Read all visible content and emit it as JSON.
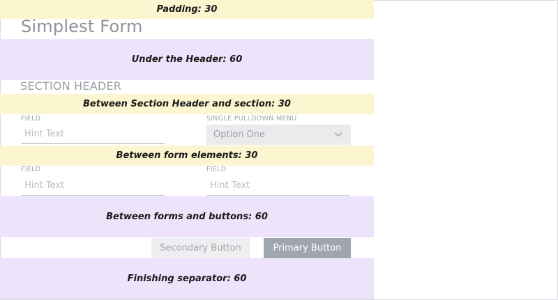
{
  "bands": {
    "padding": "Padding: 30",
    "under_header": "Under the Header: 60",
    "between_section": "Between Section Header and section: 30",
    "between_form": "Between form elements: 30",
    "between_forms_buttons": "Between forms and buttons: 60",
    "finishing": "Finishing separator: 60"
  },
  "form": {
    "title": "Simplest Form",
    "section_header": "SECTION HEADER",
    "row1": {
      "field_label": "FIELD",
      "field_placeholder": "Hint Text",
      "pulldown_label": "SINGLE PULLDOWN MENU",
      "pulldown_value": "Option One",
      "pulldown_icon": "chevron-down-icon"
    },
    "row2": {
      "field1_label": "FIELD",
      "field1_placeholder": "Hint Text",
      "field2_label": "FIELD",
      "field2_placeholder": "Hint Text"
    },
    "buttons": {
      "secondary": "Secondary Button",
      "primary": "Primary Button"
    }
  },
  "colors": {
    "yellow_band": "#fbf6d0",
    "lavender_band": "#ede4fb",
    "primary_button": "#a0a6ad",
    "secondary_button": "#eeeff1",
    "pulldown_bg": "#eaebed"
  }
}
